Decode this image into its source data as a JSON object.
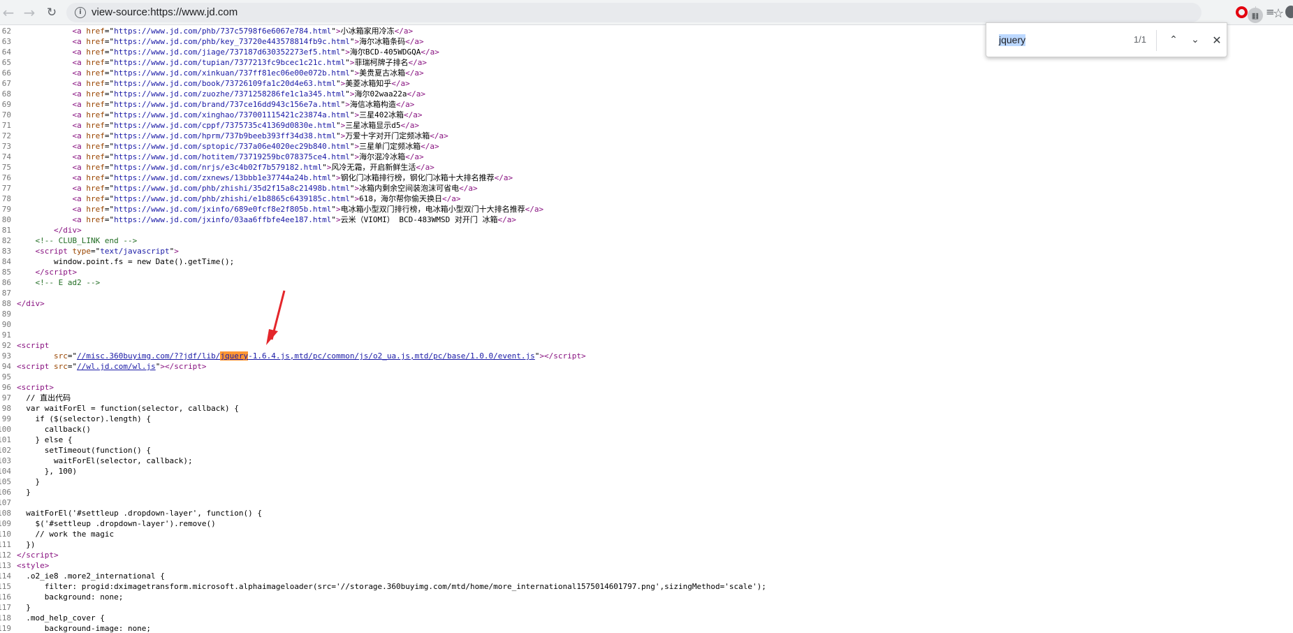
{
  "browser": {
    "url": "view-source:https://www.jd.com",
    "icons": {
      "back": "arrow-left-icon",
      "forward": "arrow-right-icon",
      "reload": "reload-icon",
      "site_info": "info-icon",
      "star": "star-icon",
      "extension": "opera-icon",
      "queue": "reading-list-icon"
    }
  },
  "find_bar": {
    "query": "jquery",
    "count": "1/1"
  },
  "lines": [
    {
      "n": "62",
      "html": "            <span class=\"tag\">&lt;a</span> <span class=\"attr\">href</span>=\"<span class=\"val\">https://www.jd.com/phb/737c5798f6e6067e784.html</span>\"<span class=\"tag\">&gt;</span>小冰箱家用冷冻<span class=\"tag\">&lt;/a&gt;</span>"
    },
    {
      "n": "63",
      "html": "            <span class=\"tag\">&lt;a</span> <span class=\"attr\">href</span>=\"<span class=\"val\">https://www.jd.com/phb/key_73720e443578814fb9c.html</span>\"<span class=\"tag\">&gt;</span>海尔冰箱条码<span class=\"tag\">&lt;/a&gt;</span>"
    },
    {
      "n": "64",
      "html": "            <span class=\"tag\">&lt;a</span> <span class=\"attr\">href</span>=\"<span class=\"val\">https://www.jd.com/jiage/737187d630352273ef5.html</span>\"<span class=\"tag\">&gt;</span>海尔BCD-405WDGQA<span class=\"tag\">&lt;/a&gt;</span>"
    },
    {
      "n": "65",
      "html": "            <span class=\"tag\">&lt;a</span> <span class=\"attr\">href</span>=\"<span class=\"val\">https://www.jd.com/tupian/7377213fc9bcec1c21c.html</span>\"<span class=\"tag\">&gt;</span>菲瑞柯牌子排名<span class=\"tag\">&lt;/a&gt;</span>"
    },
    {
      "n": "66",
      "html": "            <span class=\"tag\">&lt;a</span> <span class=\"attr\">href</span>=\"<span class=\"val\">https://www.jd.com/xinkuan/737ff81ec06e00e072b.html</span>\"<span class=\"tag\">&gt;</span>美贵夏古冰箱<span class=\"tag\">&lt;/a&gt;</span>"
    },
    {
      "n": "67",
      "html": "            <span class=\"tag\">&lt;a</span> <span class=\"attr\">href</span>=\"<span class=\"val\">https://www.jd.com/book/73726109fa1c20d4e63.html</span>\"<span class=\"tag\">&gt;</span>美菱冰箱知乎<span class=\"tag\">&lt;/a&gt;</span>"
    },
    {
      "n": "68",
      "html": "            <span class=\"tag\">&lt;a</span> <span class=\"attr\">href</span>=\"<span class=\"val\">https://www.jd.com/zuozhe/7371258286fe1c1a345.html</span>\"<span class=\"tag\">&gt;</span>海尔02waa22a<span class=\"tag\">&lt;/a&gt;</span>"
    },
    {
      "n": "69",
      "html": "            <span class=\"tag\">&lt;a</span> <span class=\"attr\">href</span>=\"<span class=\"val\">https://www.jd.com/brand/737ce16dd943c156e7a.html</span>\"<span class=\"tag\">&gt;</span>海信冰箱构造<span class=\"tag\">&lt;/a&gt;</span>"
    },
    {
      "n": "70",
      "html": "            <span class=\"tag\">&lt;a</span> <span class=\"attr\">href</span>=\"<span class=\"val\">https://www.jd.com/xinghao/737001115421c23874a.html</span>\"<span class=\"tag\">&gt;</span>三星402冰箱<span class=\"tag\">&lt;/a&gt;</span>"
    },
    {
      "n": "71",
      "html": "            <span class=\"tag\">&lt;a</span> <span class=\"attr\">href</span>=\"<span class=\"val\">https://www.jd.com/cppf/7375735c41369d0830e.html</span>\"<span class=\"tag\">&gt;</span>三星冰箱显示d5<span class=\"tag\">&lt;/a&gt;</span>"
    },
    {
      "n": "72",
      "html": "            <span class=\"tag\">&lt;a</span> <span class=\"attr\">href</span>=\"<span class=\"val\">https://www.jd.com/hprm/737b9beeb393ff34d38.html</span>\"<span class=\"tag\">&gt;</span>万爱十字对开门定频冰箱<span class=\"tag\">&lt;/a&gt;</span>"
    },
    {
      "n": "73",
      "html": "            <span class=\"tag\">&lt;a</span> <span class=\"attr\">href</span>=\"<span class=\"val\">https://www.jd.com/sptopic/737a06e4020ec29b840.html</span>\"<span class=\"tag\">&gt;</span>三星单门定频冰箱<span class=\"tag\">&lt;/a&gt;</span>"
    },
    {
      "n": "74",
      "html": "            <span class=\"tag\">&lt;a</span> <span class=\"attr\">href</span>=\"<span class=\"val\">https://www.jd.com/hotitem/73719259bc078375ce4.html</span>\"<span class=\"tag\">&gt;</span>海尔混冷冰箱<span class=\"tag\">&lt;/a&gt;</span>"
    },
    {
      "n": "75",
      "html": "            <span class=\"tag\">&lt;a</span> <span class=\"attr\">href</span>=\"<span class=\"val\">https://www.jd.com/nrjs/e3c4b02f7b579182.html</span>\"<span class=\"tag\">&gt;</span>风冷无霜，开启新鲜生活<span class=\"tag\">&lt;/a&gt;</span>"
    },
    {
      "n": "76",
      "html": "            <span class=\"tag\">&lt;a</span> <span class=\"attr\">href</span>=\"<span class=\"val\">https://www.jd.com/zxnews/13bbb1e37744a24b.html</span>\"<span class=\"tag\">&gt;</span>钢化门冰箱排行榜，钢化门冰箱十大排名推荐<span class=\"tag\">&lt;/a&gt;</span>"
    },
    {
      "n": "77",
      "html": "            <span class=\"tag\">&lt;a</span> <span class=\"attr\">href</span>=\"<span class=\"val\">https://www.jd.com/phb/zhishi/35d2f15a8c21498b.html</span>\"<span class=\"tag\">&gt;</span>冰箱内剩余空间装泡沫可省电<span class=\"tag\">&lt;/a&gt;</span>"
    },
    {
      "n": "78",
      "html": "            <span class=\"tag\">&lt;a</span> <span class=\"attr\">href</span>=\"<span class=\"val\">https://www.jd.com/phb/zhishi/e1b8865c6439185c.html</span>\"<span class=\"tag\">&gt;</span>618，海尔帮你偷天换日<span class=\"tag\">&lt;/a&gt;</span>"
    },
    {
      "n": "79",
      "html": "            <span class=\"tag\">&lt;a</span> <span class=\"attr\">href</span>=\"<span class=\"val\">https://www.jd.com/jxinfo/689e0fcf8e2f805b.html</span>\"<span class=\"tag\">&gt;</span>电冰箱小型双门排行榜，电冰箱小型双门十大排名推荐<span class=\"tag\">&lt;/a&gt;</span>"
    },
    {
      "n": "80",
      "html": "            <span class=\"tag\">&lt;a</span> <span class=\"attr\">href</span>=\"<span class=\"val\">https://www.jd.com/jxinfo/03aa6ffbfe4ee187.html</span>\"<span class=\"tag\">&gt;</span>云米（VIOMI） BCD-483WMSD 对开门 冰箱<span class=\"tag\">&lt;/a&gt;</span>"
    },
    {
      "n": "81",
      "html": "        <span class=\"tag\">&lt;/div&gt;</span>"
    },
    {
      "n": "82",
      "html": "    <span class=\"cmt\">&lt;!-- CLUB_LINK end --&gt;</span>"
    },
    {
      "n": "83",
      "html": "    <span class=\"tag\">&lt;script</span> <span class=\"attr\">type</span>=\"<span class=\"val\">text/javascript</span>\"<span class=\"tag\">&gt;</span>"
    },
    {
      "n": "84",
      "html": "        window.point.fs = new Date().getTime();"
    },
    {
      "n": "85",
      "html": "    <span class=\"tag\">&lt;/script&gt;</span>"
    },
    {
      "n": "86",
      "html": "    <span class=\"cmt\">&lt;!-- E ad2 --&gt;</span>"
    },
    {
      "n": "87",
      "html": ""
    },
    {
      "n": "88",
      "html": "<span class=\"tag\">&lt;/div&gt;</span>"
    },
    {
      "n": "89",
      "html": ""
    },
    {
      "n": "90",
      "html": ""
    },
    {
      "n": "91",
      "html": ""
    },
    {
      "n": "92",
      "html": "<span class=\"tag\">&lt;script</span>"
    },
    {
      "n": "93",
      "html": "        <span class=\"attr\">src</span>=\"<span class=\"lnk\">//misc.360buyimg.com/??jdf/lib/<span class=\"hl\">jquery</span>-1.6.4.js,mtd/pc/common/js/o2_ua.js,mtd/pc/base/1.0.0/event.js</span>\"<span class=\"tag\">&gt;&lt;/script&gt;</span>"
    },
    {
      "n": "94",
      "html": "<span class=\"tag\">&lt;script</span> <span class=\"attr\">src</span>=\"<span class=\"lnk\">//wl.jd.com/wl.js</span>\"<span class=\"tag\">&gt;&lt;/script&gt;</span>"
    },
    {
      "n": "95",
      "html": ""
    },
    {
      "n": "96",
      "html": "<span class=\"tag\">&lt;script&gt;</span>"
    },
    {
      "n": "97",
      "html": "  // 直出代码"
    },
    {
      "n": "98",
      "html": "  var waitForEl = function(selector, callback) {"
    },
    {
      "n": "99",
      "html": "    if ($(selector).length) {"
    },
    {
      "n": "100",
      "html": "      callback()"
    },
    {
      "n": "101",
      "html": "    } else {"
    },
    {
      "n": "102",
      "html": "      setTimeout(function() {"
    },
    {
      "n": "103",
      "html": "        waitForEl(selector, callback);"
    },
    {
      "n": "104",
      "html": "      }, 100)"
    },
    {
      "n": "105",
      "html": "    }"
    },
    {
      "n": "106",
      "html": "  }"
    },
    {
      "n": "107",
      "html": ""
    },
    {
      "n": "108",
      "html": "  waitForEl('#settleup .dropdown-layer', function() {"
    },
    {
      "n": "109",
      "html": "    $('#settleup .dropdown-layer').remove()"
    },
    {
      "n": "110",
      "html": "    // work the magic"
    },
    {
      "n": "111",
      "html": "  })"
    },
    {
      "n": "112",
      "html": "<span class=\"tag\">&lt;/script&gt;</span>"
    },
    {
      "n": "113",
      "html": "<span class=\"tag\">&lt;style&gt;</span>"
    },
    {
      "n": "114",
      "html": "  .o2_ie8 .more2_international {"
    },
    {
      "n": "115",
      "html": "      filter: progid:dximagetransform.microsoft.alphaimageloader(src='//storage.360buyimg.com/mtd/home/more_international1575014601797.png',sizingMethod='scale');"
    },
    {
      "n": "116",
      "html": "      background: none;"
    },
    {
      "n": "117",
      "html": "  }"
    },
    {
      "n": "118",
      "html": "  .mod_help_cover {"
    },
    {
      "n": "119",
      "html": "      background-image: none;"
    }
  ]
}
